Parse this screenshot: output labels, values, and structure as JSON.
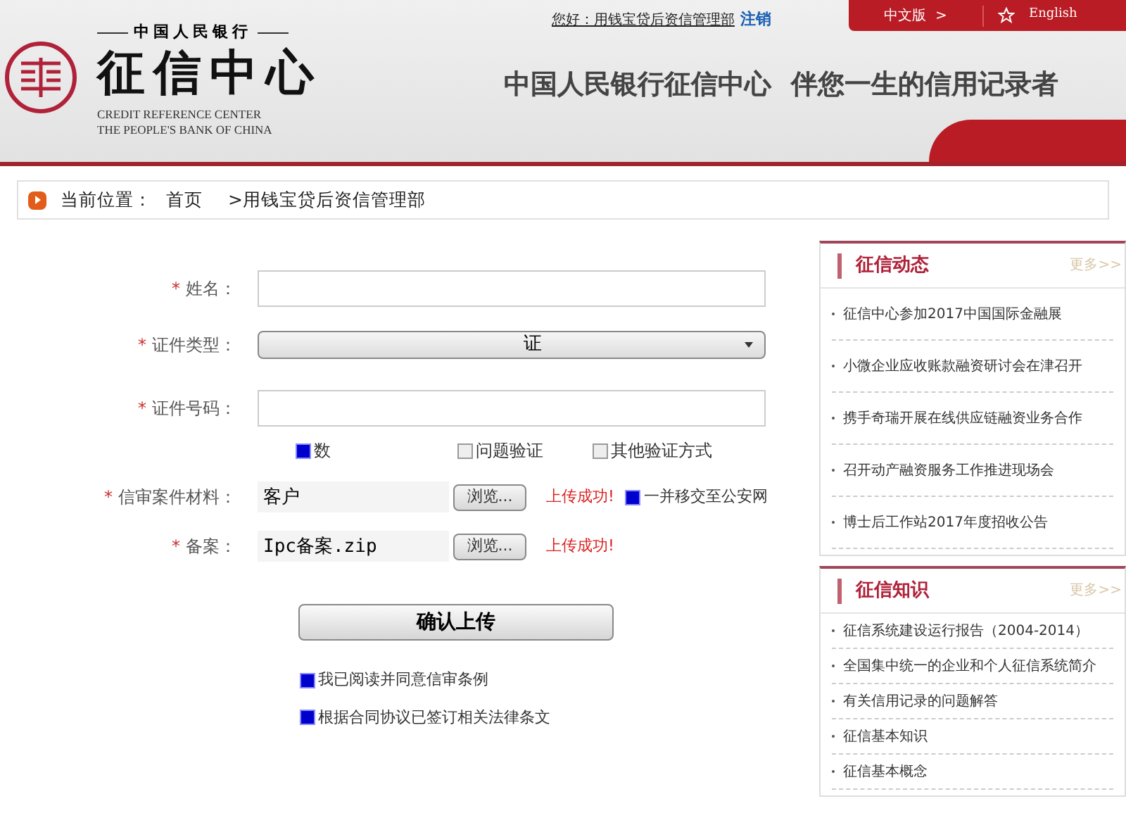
{
  "header": {
    "greeting": "您好：用钱宝贷后资信管理部",
    "logout": "注销",
    "lang_tabs": [
      {
        "label": "中文版",
        "arrow": ">",
        "kind": "text"
      },
      {
        "label": "English",
        "kind": "star"
      }
    ],
    "logo": {
      "top": "中国人民银行",
      "title": "征信中心",
      "en1": "CREDIT REFERENCE CENTER",
      "en2": "THE PEOPLE'S BANK OF CHINA"
    },
    "slogan": [
      "中国人民银行征信中心",
      "伴您一生的信用记录者"
    ]
  },
  "breadcrumb": {
    "label": "当前位置：",
    "items": [
      "首页",
      ">用钱宝贷后资信管理部"
    ]
  },
  "form": {
    "fields": [
      {
        "kind": "text",
        "label": "姓名：",
        "required": "*"
      },
      {
        "kind": "select",
        "label": "证件类型：",
        "required": "*",
        "value": "证"
      },
      {
        "kind": "text",
        "label": "证件号码：",
        "required": "*"
      },
      {
        "kind": "checks",
        "options": [
          {
            "label": "数",
            "checked": true
          },
          {
            "label": "问题验证",
            "checked": false
          },
          {
            "label": "其他验证方式",
            "checked": false
          }
        ]
      },
      {
        "kind": "file",
        "label": "信审案件材料：",
        "required": "*",
        "value": "客户",
        "browse": "浏览...",
        "status": "上传成功!",
        "extra": {
          "label": "一并移交至公安网",
          "checked": true
        }
      },
      {
        "kind": "file",
        "label": "备案：",
        "required": "*",
        "value": "Ipc备案.zip",
        "browse": "浏览...",
        "status": "上传成功!"
      }
    ],
    "submit": "确认上传",
    "agreements": [
      {
        "label": "我已阅读并同意信审条例",
        "checked": true
      },
      {
        "label": "根据合同协议已签订相关法律条文",
        "checked": true
      }
    ]
  },
  "sidebar": [
    {
      "title": "征信动态",
      "more": "更多>>",
      "items": [
        "征信中心参加2017中国国际金融展",
        "小微企业应收账款融资研讨会在津召开",
        "携手奇瑞开展在线供应链融资业务合作",
        "召开动产融资服务工作推进现场会",
        "博士后工作站2017年度招收公告"
      ]
    },
    {
      "title": "征信知识",
      "more": "更多>>",
      "items": [
        "征信系统建设运行报告（2004-2014）",
        "全国集中统一的企业和个人征信系统简介",
        "有关信用记录的问题解答",
        "征信基本知识",
        "征信基本概念"
      ]
    }
  ]
}
